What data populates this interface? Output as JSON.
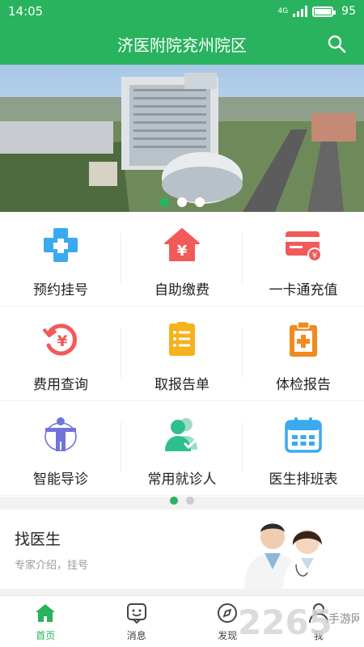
{
  "status": {
    "time": "14:05",
    "network": "4G",
    "battery": "95"
  },
  "header": {
    "title": "济医附院兖州院区",
    "search_icon": "search-icon"
  },
  "banner": {
    "slides": 3,
    "active_slide": 1
  },
  "services": [
    {
      "label": "预约挂号",
      "icon": "cross-icon",
      "color": "#3ba9f0"
    },
    {
      "label": "自助缴费",
      "icon": "house-yen-icon",
      "color": "#f25a5a"
    },
    {
      "label": "一卡通充值",
      "icon": "card-icon",
      "color": "#f25a5a"
    },
    {
      "label": "费用查询",
      "icon": "yen-history-icon",
      "color": "#f25a5a"
    },
    {
      "label": "取报告单",
      "icon": "report-icon",
      "color": "#f5b21b"
    },
    {
      "label": "体检报告",
      "icon": "medical-clipboard-icon",
      "color": "#f28a22"
    },
    {
      "label": "智能导诊",
      "icon": "body-guide-icon",
      "color": "#6f74d9"
    },
    {
      "label": "常用就诊人",
      "icon": "patients-icon",
      "color": "#2fbf8e"
    },
    {
      "label": "医生排班表",
      "icon": "calendar-icon",
      "color": "#3ba9f0"
    }
  ],
  "pager": {
    "pages": 2,
    "active": 1
  },
  "find_doctor": {
    "title": "找医生",
    "subtitle": "专家介绍，挂号"
  },
  "tabbar": [
    {
      "label": "首页",
      "icon": "home-icon",
      "active": true
    },
    {
      "label": "消息",
      "icon": "message-icon",
      "active": false
    },
    {
      "label": "发现",
      "icon": "compass-icon",
      "active": false
    },
    {
      "label": "我",
      "icon": "user-icon",
      "active": false
    }
  ],
  "watermark": {
    "text_main": "2265",
    "text_side": "手游网"
  },
  "colors": {
    "brand": "#29b35e"
  }
}
